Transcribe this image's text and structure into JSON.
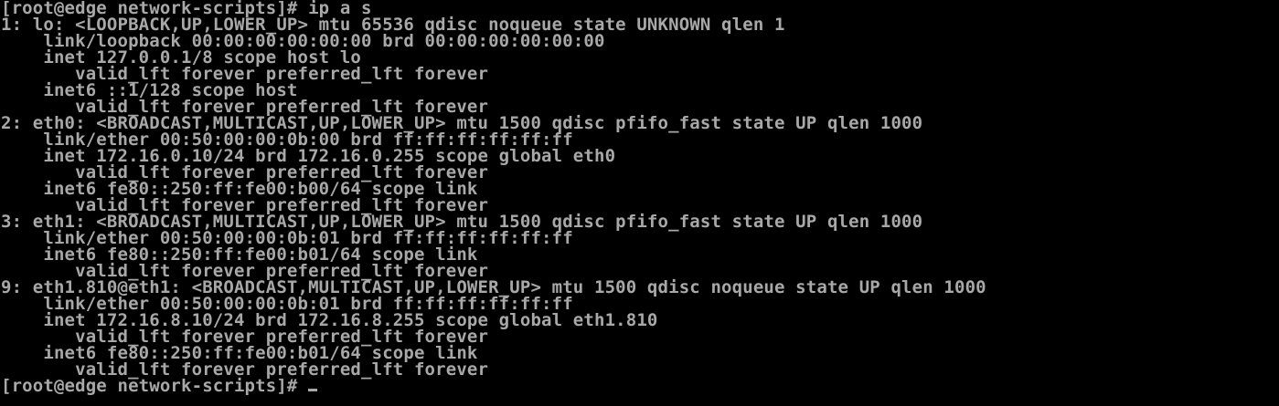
{
  "terminal": {
    "prompt": "[root@edge network-scripts]# ",
    "command": "ip a s",
    "output": [
      "1: lo: <LOOPBACK,UP,LOWER_UP> mtu 65536 qdisc noqueue state UNKNOWN qlen 1",
      "    link/loopback 00:00:00:00:00:00 brd 00:00:00:00:00:00",
      "    inet 127.0.0.1/8 scope host lo",
      "       valid_lft forever preferred_lft forever",
      "    inet6 ::1/128 scope host",
      "       valid_lft forever preferred_lft forever",
      "2: eth0: <BROADCAST,MULTICAST,UP,LOWER_UP> mtu 1500 qdisc pfifo_fast state UP qlen 1000",
      "    link/ether 00:50:00:00:0b:00 brd ff:ff:ff:ff:ff:ff",
      "    inet 172.16.0.10/24 brd 172.16.0.255 scope global eth0",
      "       valid_lft forever preferred_lft forever",
      "    inet6 fe80::250:ff:fe00:b00/64 scope link",
      "       valid_lft forever preferred_lft forever",
      "3: eth1: <BROADCAST,MULTICAST,UP,LOWER_UP> mtu 1500 qdisc pfifo_fast state UP qlen 1000",
      "    link/ether 00:50:00:00:0b:01 brd ff:ff:ff:ff:ff:ff",
      "    inet6 fe80::250:ff:fe00:b01/64 scope link",
      "       valid_lft forever preferred_lft forever",
      "9: eth1.810@eth1: <BROADCAST,MULTICAST,UP,LOWER_UP> mtu 1500 qdisc noqueue state UP qlen 1000",
      "    link/ether 00:50:00:00:0b:01 brd ff:ff:ff:ff:ff:ff",
      "    inet 172.16.8.10/24 brd 172.16.8.255 scope global eth1.810",
      "       valid_lft forever preferred_lft forever",
      "    inet6 fe80::250:ff:fe00:b01/64 scope link",
      "       valid_lft forever preferred_lft forever"
    ],
    "final_prompt": "[root@edge network-scripts]# ",
    "colors": {
      "background": "#000000",
      "foreground": "#a8a8a8"
    }
  }
}
